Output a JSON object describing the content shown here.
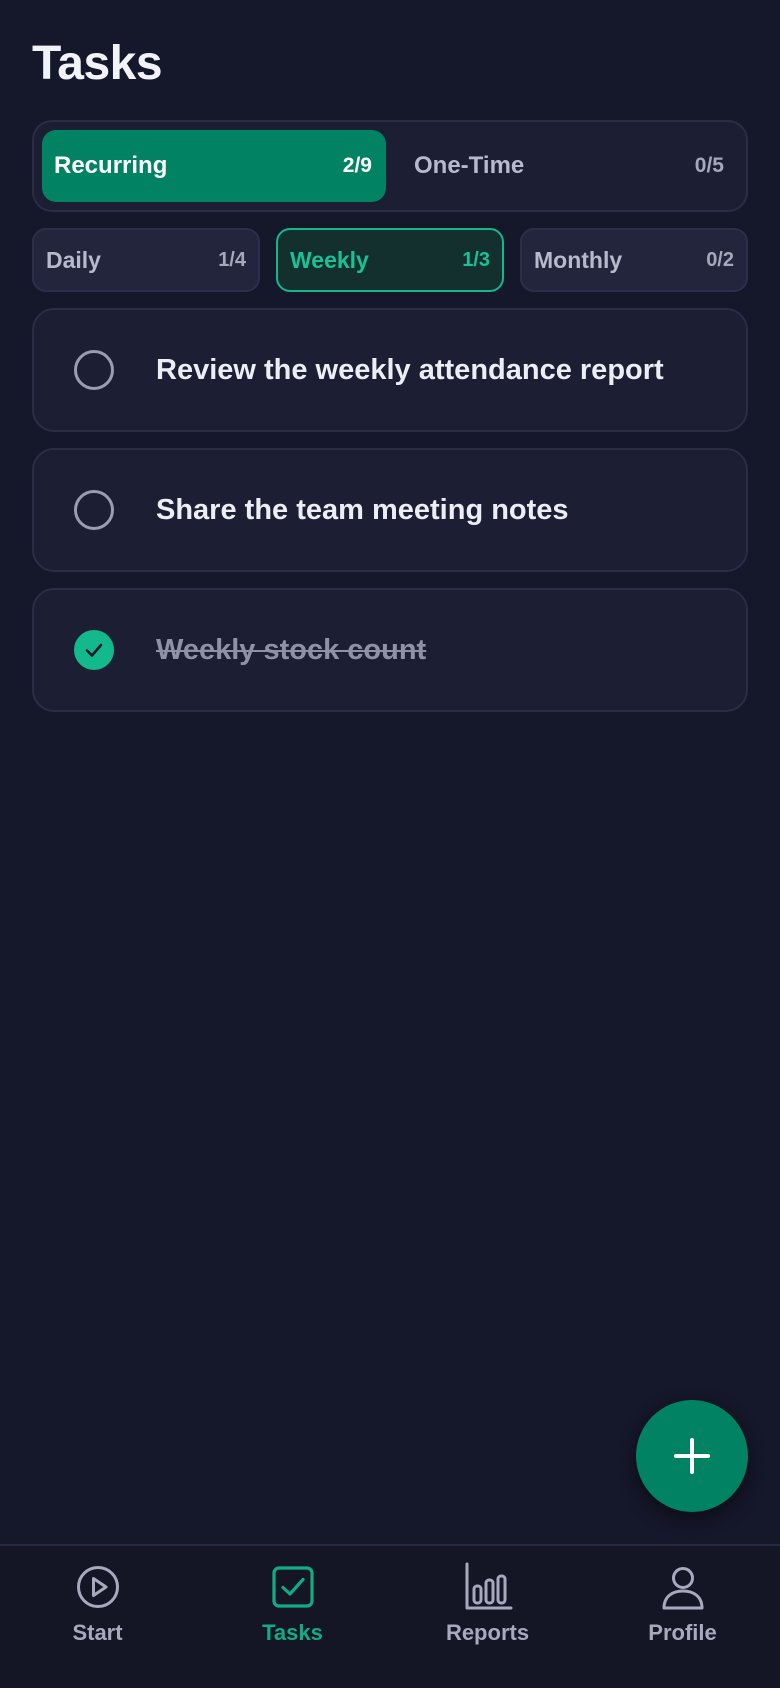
{
  "header": {
    "title": "Tasks"
  },
  "segments": [
    {
      "label": "Recurring",
      "count": "2/9",
      "active": true
    },
    {
      "label": "One-Time",
      "count": "0/5",
      "active": false
    }
  ],
  "filters": [
    {
      "label": "Daily",
      "count": "1/4",
      "active": false
    },
    {
      "label": "Weekly",
      "count": "1/3",
      "active": true
    },
    {
      "label": "Monthly",
      "count": "0/2",
      "active": false
    }
  ],
  "tasks": [
    {
      "text": "Review the weekly attendance report",
      "done": false
    },
    {
      "text": "Share the team meeting notes",
      "done": false
    },
    {
      "text": "Weekly stock count",
      "done": true
    }
  ],
  "fab": {
    "icon": "plus-icon"
  },
  "nav": [
    {
      "label": "Start",
      "icon": "play-circle-icon",
      "active": false
    },
    {
      "label": "Tasks",
      "icon": "checkbox-icon",
      "active": true
    },
    {
      "label": "Reports",
      "icon": "bar-chart-icon",
      "active": false
    },
    {
      "label": "Profile",
      "icon": "person-icon",
      "active": false
    }
  ],
  "colors": {
    "background": "#15172a",
    "accent": "#018263",
    "accent_bright": "#13b98c",
    "card": "#1c1e33"
  }
}
